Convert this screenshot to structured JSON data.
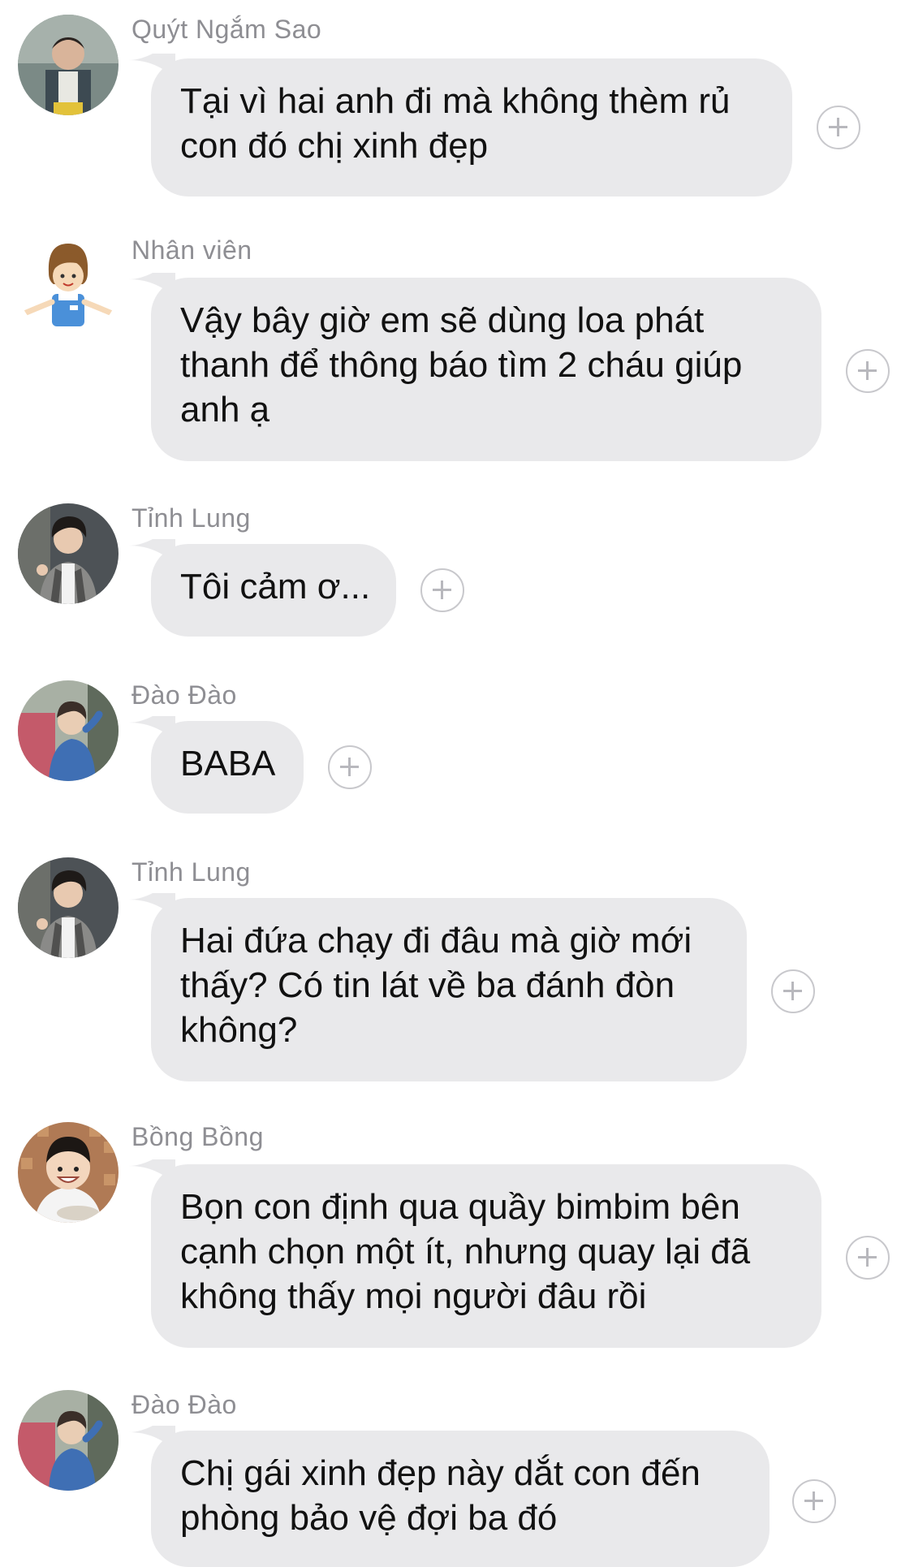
{
  "messages": [
    {
      "sender": "Quýt Ngắm Sao",
      "avatar": "boy-photo-avatar",
      "lines": [
        "Tại vì hai anh đi mà không thèm rủ",
        "con đó chị xinh đẹp"
      ],
      "add_icon": "plus-circle-icon"
    },
    {
      "sender": "Nhân viên",
      "avatar": "staff-cartoon-avatar",
      "lines": [
        "Vậy bây giờ em sẽ dùng loa phát",
        "thanh để thông báo tìm 2 cháu giúp",
        "anh ạ"
      ],
      "add_icon": "plus-circle-icon"
    },
    {
      "sender": "Tỉnh Lung",
      "avatar": "man-photo-avatar",
      "lines": [
        "Tôi cảm ơ..."
      ],
      "add_icon": "plus-circle-icon"
    },
    {
      "sender": "Đào Đào",
      "avatar": "child-photo-avatar",
      "lines": [
        "BABA"
      ],
      "add_icon": "plus-circle-icon"
    },
    {
      "sender": "Tỉnh Lung",
      "avatar": "man-photo-avatar",
      "lines": [
        "Hai đứa chạy đi đâu mà giờ mới",
        "thấy? Có tin lát về ba đánh đòn",
        "không?"
      ],
      "add_icon": "plus-circle-icon"
    },
    {
      "sender": "Bồng Bồng",
      "avatar": "smiling-boy-photo-avatar",
      "lines": [
        "Bọn con định qua quầy bimbim bên",
        "cạnh chọn một ít, nhưng quay lại đã",
        "không thấy mọi người đâu rồi"
      ],
      "add_icon": "plus-circle-icon"
    },
    {
      "sender": "Đào Đào",
      "avatar": "child-photo-avatar",
      "lines": [
        "Chị gái xinh đẹp này dắt con đến",
        "phòng bảo vệ đợi ba đó"
      ],
      "add_icon": "plus-circle-icon"
    }
  ],
  "colors": {
    "bubble": "#e9e9eb",
    "name": "#8e8e93",
    "text": "#111111",
    "plus": "#c8c8cc"
  }
}
